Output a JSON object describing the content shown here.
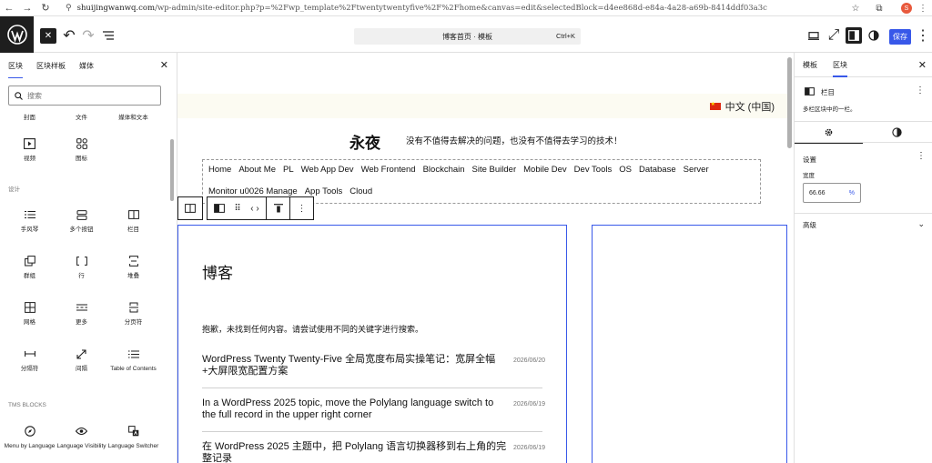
{
  "browser": {
    "url_host": "shuijingwanwq.com",
    "url_path": "/wp-admin/site-editor.php?p=%2Fwp_template%2Ftwentytwentyfive%2F%2Fhome&canvas=edit&selectedBlock=d4ee868d-e84a-4a28-a69b-8414ddf03a3c",
    "avatar_letter": "S"
  },
  "header": {
    "doc_title": "博客首页 · 模板",
    "shortcut": "Ctrl+K",
    "save_label": "保存"
  },
  "inserter": {
    "tabs": [
      "区块",
      "区块样板",
      "媒体"
    ],
    "search_placeholder": "搜索",
    "partial_row": [
      "封面",
      "文件",
      "媒体和文本"
    ],
    "media_items": [
      {
        "label": "视频",
        "icon": "video-icon"
      },
      {
        "label": "图标",
        "icon": "icons-icon"
      }
    ],
    "design_category": "设计",
    "design_items": [
      {
        "label": "手风琴",
        "icon": "accordion-icon"
      },
      {
        "label": "多个按钮",
        "icon": "buttons-icon"
      },
      {
        "label": "栏目",
        "icon": "columns-icon"
      },
      {
        "label": "群组",
        "icon": "group-icon"
      },
      {
        "label": "行",
        "icon": "row-icon"
      },
      {
        "label": "堆叠",
        "icon": "stack-icon"
      },
      {
        "label": "网格",
        "icon": "grid-icon"
      },
      {
        "label": "更多",
        "icon": "more-icon"
      },
      {
        "label": "分页符",
        "icon": "page-break-icon"
      },
      {
        "label": "分隔符",
        "icon": "separator-icon"
      },
      {
        "label": "间隔",
        "icon": "spacer-icon"
      },
      {
        "label": "Table of Contents",
        "icon": "toc-icon"
      }
    ],
    "tms_category": "TMS BLOCKS",
    "tms_items": [
      {
        "label": "Menu by Language",
        "icon": "compass-icon"
      },
      {
        "label": "Language Visibility",
        "icon": "eye-icon"
      },
      {
        "label": "Language Switcher",
        "icon": "translate-icon"
      }
    ]
  },
  "canvas": {
    "language": "中文 (中国)",
    "site_title": "永夜",
    "tagline": "没有不值得去解决的问题，也没有不值得去学习的技术！",
    "nav_row1": [
      "Home",
      "About Me",
      "PL",
      "Web App Dev",
      "Web Frontend",
      "Blockchain",
      "Site Builder",
      "Mobile Dev",
      "Dev Tools",
      "OS",
      "Database",
      "Server"
    ],
    "nav_row2": [
      "Monitor u0026 Manage",
      "App Tools",
      "Cloud"
    ],
    "blog_heading": "博客",
    "no_results": "抱歉，未找到任何内容。请尝试使用不同的关键字进行搜索。",
    "posts": [
      {
        "title": "WordPress Twenty Twenty-Five 全局宽度布局实操笔记：宽屏全幅+大屏限宽配置方案",
        "date": "2026/06/20"
      },
      {
        "title": "In a WordPress 2025 topic, move the Polylang language switch to the full record in the upper right corner",
        "date": "2026/06/19"
      },
      {
        "title": "在 WordPress 2025 主题中，把 Polylang 语言切换器移到右上角的完整记录",
        "date": "2026/06/19"
      }
    ]
  },
  "settings_panel": {
    "tabs": [
      "模板",
      "区块"
    ],
    "block_name": "栏目",
    "block_desc": "多栏区块中的一栏。",
    "settings_title": "设置",
    "width_label": "宽度",
    "width_value": "66.66",
    "width_unit": "%",
    "advanced_label": "高级"
  },
  "colors": {
    "accent": "#3858e9",
    "dark": "#1e1e1e",
    "lang_bar_bg": "#fcfbf2"
  }
}
